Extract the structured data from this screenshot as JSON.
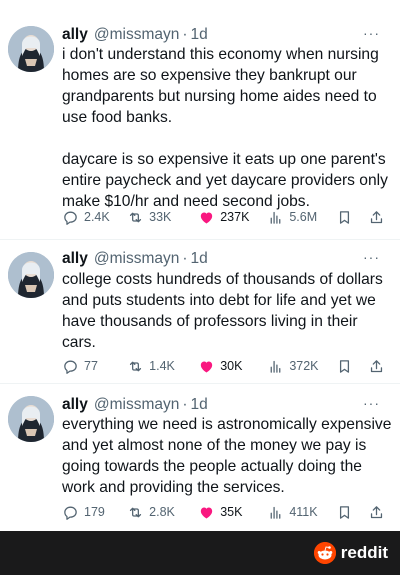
{
  "tweets": [
    {
      "name": "ally",
      "handle": "@missmayn",
      "dot": "·",
      "time": "1d",
      "more": "···",
      "text": "i don't understand this economy when nursing homes are so expensive they bankrupt our grandparents but nursing home aides need to use food banks.\n\ndaycare is so expensive it eats up one parent's entire paycheck and yet daycare providers only make $10/hr and need second jobs.",
      "replies": "2.4K",
      "retweets": "33K",
      "likes": "237K",
      "views": "5.6M"
    },
    {
      "name": "ally",
      "handle": "@missmayn",
      "dot": "·",
      "time": "1d",
      "more": "···",
      "text": "college costs hundreds of thousands of dollars and puts students into debt for life and yet we have thousands of professors living in their cars.",
      "replies": "77",
      "retweets": "1.4K",
      "likes": "30K",
      "views": "372K"
    },
    {
      "name": "ally",
      "handle": "@missmayn",
      "dot": "·",
      "time": "1d",
      "more": "···",
      "text": "everything we need is astronomically expensive and yet almost none of the money we pay is going towards the people actually doing the work and providing the services.",
      "replies": "179",
      "retweets": "2.8K",
      "likes": "35K",
      "views": "411K"
    }
  ],
  "footer": {
    "brand": "reddit"
  },
  "icons": {
    "reply": "reply-icon",
    "retweet": "retweet-icon",
    "like": "heart-icon",
    "views": "views-icon",
    "bookmark": "bookmark-icon",
    "share": "share-icon"
  },
  "colors": {
    "like": "#f91880",
    "muted": "#536471",
    "retweet_hover": "#00ba7c",
    "reddit": "#ff4500"
  }
}
